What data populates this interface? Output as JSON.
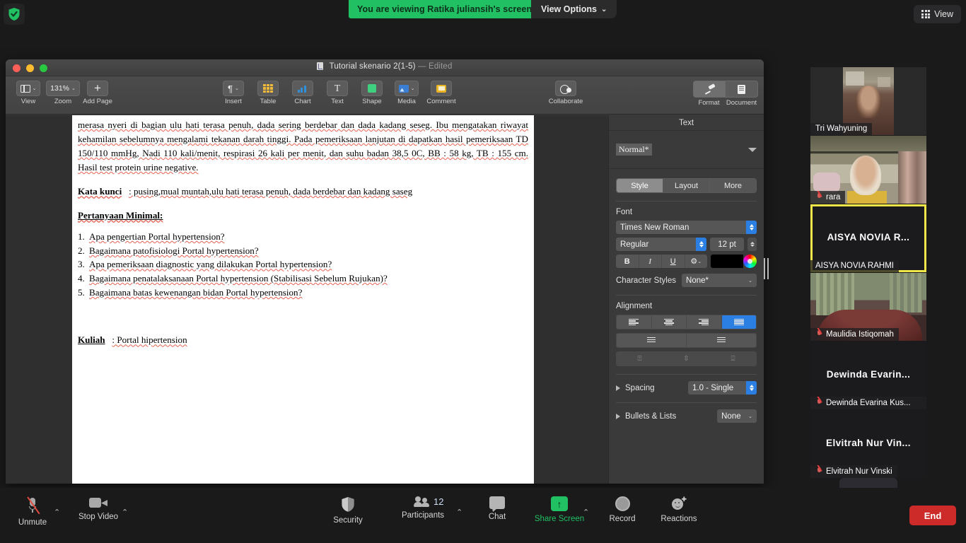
{
  "meeting": {
    "encryption_icon": "shield-check-icon",
    "viewing_banner": "You are viewing Ratika juliansih's screen",
    "view_options_label": "View Options",
    "view_button_label": "View",
    "accent_green": "#21c063",
    "end_button_color": "#cc2b29",
    "active_speaker_border": "#f0e64a"
  },
  "shared_app": {
    "window_title": "Tutorial skenario 2(1-5)",
    "window_state": "— Edited",
    "toolbar_left": [
      {
        "label": "View",
        "icon": "view-layout-icon",
        "has_menu": true
      },
      {
        "label": "Zoom",
        "icon": "zoom-level-icon",
        "value": "131%",
        "has_menu": true
      },
      {
        "label": "Add Page",
        "icon": "plus-icon",
        "has_menu": false
      }
    ],
    "toolbar_center": [
      {
        "label": "Insert",
        "icon": "paragraph-mark-icon",
        "has_menu": true
      },
      {
        "label": "Table",
        "icon": "table-icon",
        "has_menu": false
      },
      {
        "label": "Chart",
        "icon": "bar-chart-icon",
        "has_menu": false
      },
      {
        "label": "Text",
        "icon": "text-box-icon",
        "has_menu": false
      },
      {
        "label": "Shape",
        "icon": "shape-icon",
        "has_menu": false
      },
      {
        "label": "Media",
        "icon": "media-image-icon",
        "has_menu": true
      },
      {
        "label": "Comment",
        "icon": "comment-icon",
        "has_menu": false
      }
    ],
    "toolbar_right": [
      {
        "label": "Collaborate",
        "icon": "collaborate-icon"
      },
      {
        "label": "Format",
        "icon": "format-brush-icon",
        "active": true
      },
      {
        "label": "Document",
        "icon": "document-icon",
        "active": false
      }
    ]
  },
  "document": {
    "paragraph_1": "merasa nyeri di bagian ulu hati terasa penuh, dada sering berdebar dan dada kadang seseg. Ibu mengatakan riwayat kehamilan sebelumnya mengalami tekanan darah tinggi. Pada pemeriksaan lanjutan di dapatkan hasil pemeriksaan TD 150/110 mmHg, Nadi 110 kali/menit, respirasi 26 kali per menit, dan suhu badan 38,5 0C, BB : 58 kg, TB : 155 cm. Hasil test protein urine negative.",
    "keywords_label": "Kata kunci",
    "keywords_value": ": pusing,mual muntah,ulu hati terasa penuh, dada berdebar dan kadang saseg",
    "questions_heading": "Pertanyaan Minimal:",
    "questions": [
      "Apa pengertian Portal hypertension?",
      "Bagaimana patofisiologi Portal hypertension?",
      "Apa pemeriksaan diagnostic yang dilakukan Portal hypertension?",
      "Bagaimana penatalaksanaan Portal hypertension (Stabilisasi Sebelum Rujukan)?",
      "Bagaimana batas kewenangan bidan Portal hypertension?"
    ],
    "lecture_label": "Kuliah",
    "lecture_value": ": Portal hipertension"
  },
  "inspector": {
    "header": "Text",
    "paragraph_style": "Normal*",
    "tabs": [
      {
        "label": "Style",
        "active": true
      },
      {
        "label": "Layout",
        "active": false
      },
      {
        "label": "More",
        "active": false
      }
    ],
    "font_section_label": "Font",
    "font_family": "Times New Roman",
    "font_weight": "Regular",
    "font_size": "12 pt",
    "bold_label": "B",
    "italic_label": "I",
    "underline_label": "U",
    "more_options_label": "⚙",
    "font_color": "#000000",
    "character_styles_label": "Character Styles",
    "character_styles_value": "None*",
    "alignment_label": "Alignment",
    "alignment_selected": "justify",
    "alignment_options": [
      "left",
      "center",
      "right",
      "justify"
    ],
    "indent_options": [
      "decrease-indent",
      "increase-indent"
    ],
    "vertical_align_options": [
      "align-top",
      "align-middle",
      "align-bottom"
    ],
    "spacing_label": "Spacing",
    "spacing_value": "1.0 - Single",
    "bullets_label": "Bullets & Lists",
    "bullets_value": "None"
  },
  "participants": [
    {
      "center_name": "",
      "name": "Tri Wahyuning",
      "muted": false,
      "video": true,
      "active": false
    },
    {
      "center_name": "",
      "name": "rara",
      "muted": true,
      "video": true,
      "active": false
    },
    {
      "center_name": "AISYA NOVIA R...",
      "name": "AISYA NOVIA RAHMI",
      "muted": false,
      "video": false,
      "active": true
    },
    {
      "center_name": "",
      "name": "Maulidia Istiqomah",
      "muted": true,
      "video": true,
      "active": false
    },
    {
      "center_name": "Dewinda  Evarin...",
      "name": "Dewinda Evarina Kus...",
      "muted": true,
      "video": false,
      "active": false
    },
    {
      "center_name": "Elvitrah  Nur  Vin...",
      "name": "Elvitrah Nur Vinski",
      "muted": true,
      "video": false,
      "active": false
    }
  ],
  "filmstrip": {
    "scroll_down_icon": "chevron-down-icon"
  },
  "controls": [
    {
      "label": "Unmute",
      "icon": "mic-muted-icon",
      "has_caret": true,
      "green": false
    },
    {
      "label": "Stop Video",
      "icon": "camera-icon",
      "has_caret": true,
      "green": false
    },
    {
      "label": "Security",
      "icon": "shield-icon",
      "has_caret": false,
      "green": false
    },
    {
      "label": "Participants",
      "icon": "people-icon",
      "has_caret": true,
      "green": false,
      "badge": "12"
    },
    {
      "label": "Chat",
      "icon": "chat-bubble-icon",
      "has_caret": false,
      "green": false
    },
    {
      "label": "Share Screen",
      "icon": "share-screen-icon",
      "has_caret": true,
      "green": true
    },
    {
      "label": "Record",
      "icon": "record-icon",
      "has_caret": false,
      "green": false
    },
    {
      "label": "Reactions",
      "icon": "reactions-icon",
      "has_caret": false,
      "green": false
    }
  ],
  "end_button_label": "End"
}
